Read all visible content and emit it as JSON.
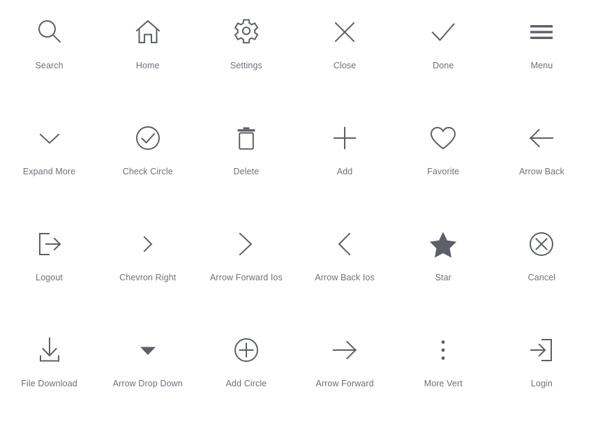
{
  "gallery": {
    "background_color": "#ffffff",
    "icon_color": "#5d6067",
    "label_color": "#6f7179",
    "columns": 6,
    "rows": 4,
    "icons": [
      {
        "name": "search-icon",
        "label": "Search"
      },
      {
        "name": "home-icon",
        "label": "Home"
      },
      {
        "name": "settings-icon",
        "label": "Settings"
      },
      {
        "name": "close-icon",
        "label": "Close"
      },
      {
        "name": "done-icon",
        "label": "Done"
      },
      {
        "name": "menu-icon",
        "label": "Menu"
      },
      {
        "name": "expand-more-icon",
        "label": "Expand More"
      },
      {
        "name": "check-circle-icon",
        "label": "Check Circle"
      },
      {
        "name": "delete-icon",
        "label": "Delete"
      },
      {
        "name": "add-icon",
        "label": "Add"
      },
      {
        "name": "favorite-icon",
        "label": "Favorite"
      },
      {
        "name": "arrow-back-icon",
        "label": "Arrow Back"
      },
      {
        "name": "logout-icon",
        "label": "Logout"
      },
      {
        "name": "chevron-right-icon",
        "label": "Chevron Right"
      },
      {
        "name": "arrow-forward-ios-icon",
        "label": "Arrow Forward Ios"
      },
      {
        "name": "arrow-back-ios-icon",
        "label": "Arrow Back Ios"
      },
      {
        "name": "star-icon",
        "label": "Star"
      },
      {
        "name": "cancel-icon",
        "label": "Cancel"
      },
      {
        "name": "file-download-icon",
        "label": "File Download"
      },
      {
        "name": "arrow-drop-down-icon",
        "label": "Arrow Drop Down"
      },
      {
        "name": "add-circle-icon",
        "label": "Add Circle"
      },
      {
        "name": "arrow-forward-icon",
        "label": "Arrow Forward"
      },
      {
        "name": "more-vert-icon",
        "label": "More Vert"
      },
      {
        "name": "login-icon",
        "label": "Login"
      }
    ]
  }
}
